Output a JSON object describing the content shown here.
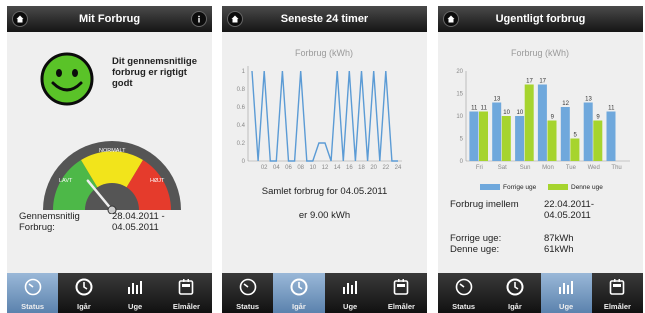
{
  "status_screen": {
    "title": "Mit Forbrug",
    "message": "Dit gennemsnitlige forbrug er rigtigt godt",
    "gauge": {
      "label_low": "LAVT",
      "label_normal": "NORMALT",
      "label_high": "HØJT",
      "level_fraction": 0.28,
      "colors": {
        "low": "#4db848",
        "normal": "#f2e41b",
        "high": "#e53b2c"
      }
    },
    "period_label": "Gennemsnitlig Forbrug:",
    "period_value": "28.04.2011 - 04.05.2011"
  },
  "yesterday_screen": {
    "title": "Seneste 24 timer",
    "chart_title": "Forbrug  (kWh)",
    "total_label": "Samlet forbrug for 04.05.2011",
    "total_value": "er 9.00 kWh"
  },
  "week_screen": {
    "title": "Ugentligt forbrug",
    "chart_title": "Forbrug  (kWh)",
    "legend_prev": "Forrige uge",
    "legend_curr": "Denne uge",
    "between_label": "Forbrug imellem",
    "between_value": "22.04.2011- 04.05.2011",
    "prev_label": "Forrige uge:",
    "prev_value": "87kWh",
    "curr_label": "Denne uge:",
    "curr_value": "61kWh"
  },
  "tabs": [
    "Status",
    "Igår",
    "Uge",
    "Elmåler"
  ],
  "colors": {
    "accent_line": "#5b9bd5",
    "prev_bar": "#6fa8dc",
    "curr_bar": "#a6d42e",
    "tab_active": "#6f95c0"
  },
  "chart_data": [
    {
      "type": "line",
      "title": "Forbrug  (kWh)",
      "x": [
        "02",
        "04",
        "06",
        "08",
        "10",
        "12",
        "14",
        "16",
        "18",
        "20",
        "22",
        "24"
      ],
      "x_hours": [
        0,
        1,
        2,
        3,
        4,
        5,
        6,
        7,
        8,
        9,
        10,
        11,
        12,
        13,
        14,
        15,
        16,
        17,
        18,
        19,
        20,
        21,
        22,
        23,
        24
      ],
      "series": [
        {
          "values": [
            1,
            0,
            1,
            0,
            0,
            1,
            0,
            0,
            1,
            0,
            0,
            0.2,
            0.2,
            0,
            1,
            0,
            1,
            0,
            1,
            0,
            1,
            0,
            1,
            0,
            0
          ]
        }
      ],
      "yticks": [
        "0",
        "0.2",
        "0.4",
        "0.6",
        "0.8",
        "1"
      ],
      "ylim": [
        0,
        1
      ],
      "grid": false
    },
    {
      "type": "bar",
      "title": "Forbrug  (kWh)",
      "categories": [
        "Fri",
        "Sat",
        "Sun",
        "Mon",
        "Tue",
        "Wed",
        "Thu"
      ],
      "series": [
        {
          "name": "Forrige uge",
          "values": [
            11,
            13,
            10,
            17,
            12,
            13,
            11
          ]
        },
        {
          "name": "Denne uge",
          "values": [
            11,
            10,
            17,
            9,
            5,
            9,
            null
          ]
        }
      ],
      "yticks": [
        "0",
        "5",
        "10",
        "15",
        "20"
      ],
      "ylim": [
        0,
        20
      ],
      "data_labels": true,
      "legend": "bottom"
    }
  ]
}
